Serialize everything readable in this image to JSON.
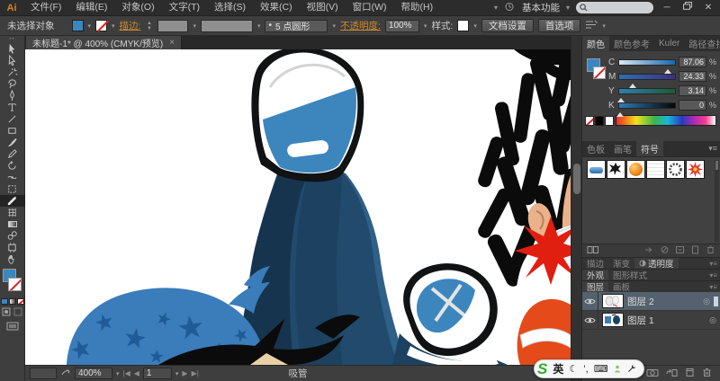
{
  "app": {
    "logo": "Ai",
    "workspace": "基本功能",
    "search_value": ""
  },
  "menu_items": [
    "文件(F)",
    "编辑(E)",
    "对象(O)",
    "文字(T)",
    "选择(S)",
    "效果(C)",
    "视图(V)",
    "窗口(W)",
    "帮助(H)"
  ],
  "control_bar": {
    "status_text": "未选择对象",
    "stroke_link": "描边:",
    "brush_bullet": "•",
    "brush_name": "5 点圆形",
    "opacity_link": "不透明度:",
    "opacity_value": "100%",
    "style_label": "样式:",
    "document_setup_button": "文档设置",
    "preferences_button": "首选项"
  },
  "document_tab": {
    "title": "未标题-1* @ 400% (CMYK/预览)",
    "close_glyph": "×"
  },
  "color_panel": {
    "tabs": [
      "颜色",
      "颜色参考",
      "Kuler",
      "路径查找器"
    ],
    "active_tab": "颜色",
    "unit": "%",
    "sliders": [
      {
        "label": "C",
        "value": "87.06",
        "percent": 87
      },
      {
        "label": "M",
        "value": "24.33",
        "percent": 24
      },
      {
        "label": "Y",
        "value": "3.14",
        "percent": 3
      },
      {
        "label": "K",
        "value": "0",
        "percent": 0
      }
    ]
  },
  "symbols_panel": {
    "tabs": [
      "色板",
      "画笔",
      "符号"
    ],
    "active_tab": "符号",
    "symbol_names": [
      "blue-brush-stroke",
      "ink-splatter",
      "orange-orb",
      "paper-texture",
      "foliage-wreath",
      "red-flower"
    ]
  },
  "collapsed_groups": {
    "row1": [
      "描边",
      "渐变",
      "透明度"
    ],
    "row1_active": "透明度",
    "row2": [
      "外观",
      "图形样式"
    ],
    "row2_active": "外观"
  },
  "layers_panel": {
    "tabs": [
      "图层",
      "画板"
    ],
    "active_tab": "图层",
    "layers": [
      {
        "name": "图层 2",
        "selected": true
      },
      {
        "name": "图层 1",
        "selected": false
      }
    ]
  },
  "status_bar": {
    "zoom": "400%",
    "artboard_number": "1",
    "tool_name": "吸管"
  },
  "ime_bar": {
    "brand_glyph": "S",
    "mode": "英",
    "moon_glyph": "☾",
    "punct_glyph": "’,",
    "keyboard_glyph": "⌨"
  },
  "icons": {
    "panel_collapse": "»",
    "layer_target": "◎",
    "chevron_down": "▼"
  },
  "colors": {
    "accent_orange": "#cf8a2b",
    "ui_dark": "#2c2c2c",
    "ui_mid": "#3e3e3e",
    "fill_blue": "#3a87c0",
    "selected_layer_row": "#55616e",
    "art": {
      "shoe_blue": "#3c86bd",
      "pant_navy": "#214a6d",
      "pant_shadow": "#17344e",
      "pant_highlight": "#2e6088",
      "bandana_blue": "#3b7cba",
      "star_blue": "#1f5c97",
      "sleeve_orange": "#e44a1a",
      "burst_red": "#e01f10",
      "skin": "#eab28a",
      "hair": "#0b0b0b"
    }
  }
}
